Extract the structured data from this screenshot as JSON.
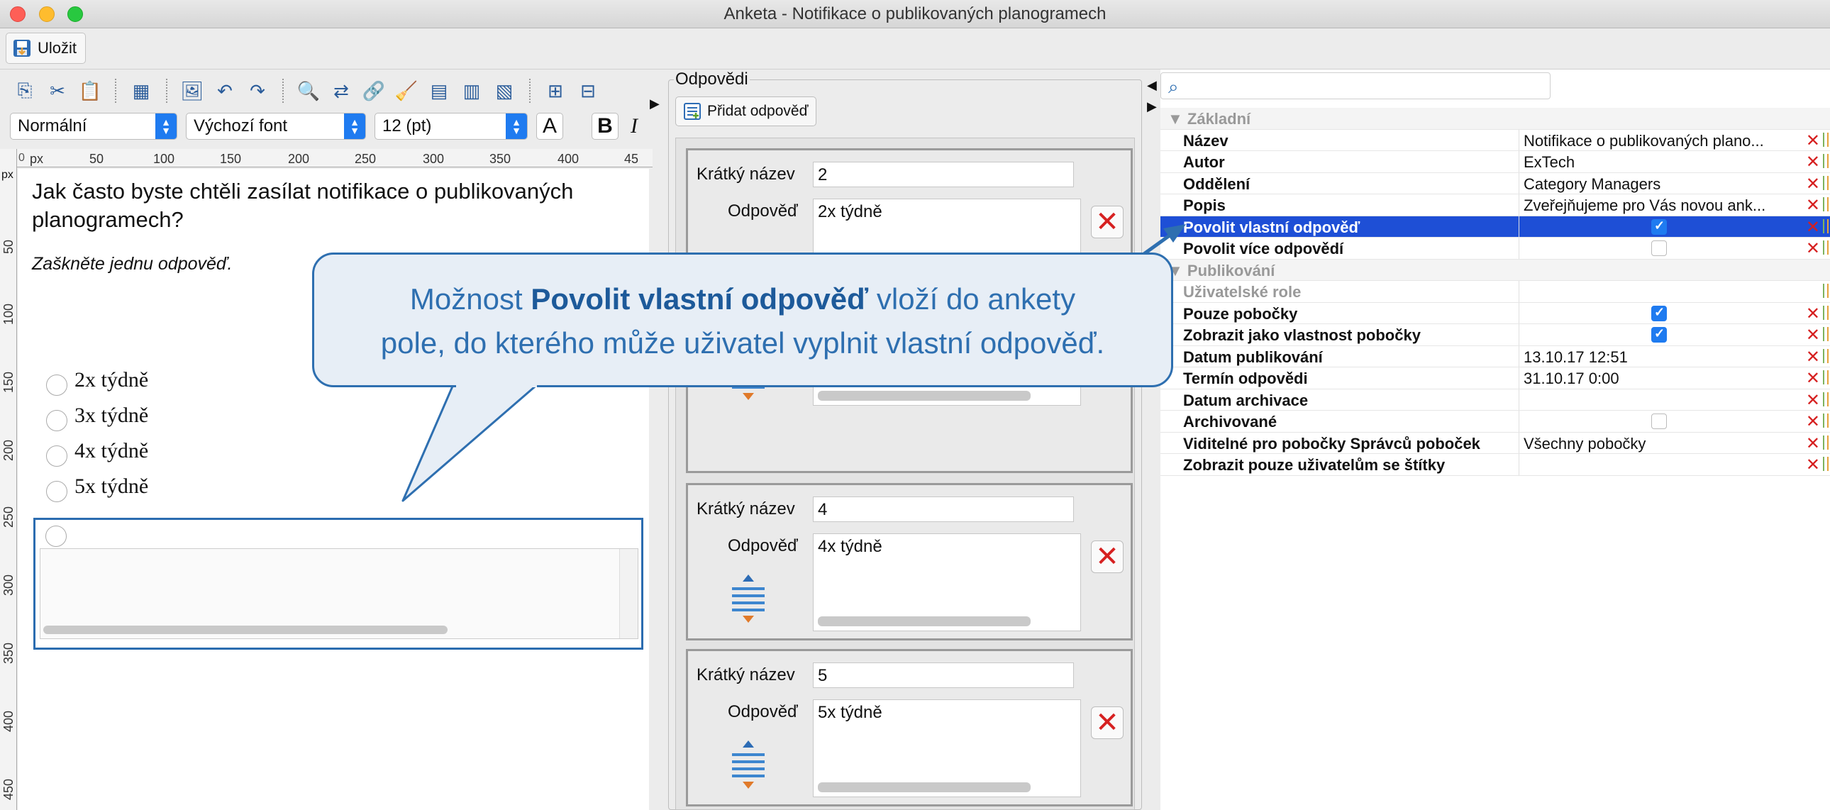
{
  "window": {
    "title": "Anketa - Notifikace o publikovaných planogramech"
  },
  "topbar": {
    "save_label": "Uložit"
  },
  "format": {
    "style": "Normální",
    "font": "Výchozí font",
    "size": "12 (pt)",
    "font_color_glyph": "A",
    "bold_glyph": "B",
    "italic_glyph": "I"
  },
  "ruler": {
    "unit": "px",
    "h_ticks": [
      "0",
      "50",
      "100",
      "150",
      "200",
      "250",
      "300",
      "350",
      "400",
      "45"
    ],
    "v_ticks": [
      "50",
      "100",
      "150",
      "200",
      "250",
      "300",
      "350",
      "400",
      "450"
    ]
  },
  "editor": {
    "question": "Jak často byste chtěli zasílat notifikace o publikovaných planogramech?",
    "instruction": "Zaškněte jednu odpověď.",
    "options": [
      "2x týdně",
      "3x týdně",
      "4x týdně",
      "5x týdně"
    ]
  },
  "answers": {
    "legend": "Odpovědi",
    "add_label": "Přidat odpověď",
    "short_label": "Krátký název",
    "answer_label": "Odpověď",
    "items": [
      {
        "short": "2",
        "text": "2x týdně"
      },
      {
        "short": "",
        "text": ""
      },
      {
        "short": "4",
        "text": "4x týdně"
      },
      {
        "short": "5",
        "text": "5x týdně"
      }
    ]
  },
  "properties": {
    "search_placeholder": "",
    "section_basic": "Základní",
    "section_publish": "Publikování",
    "rows": [
      {
        "name": "Název",
        "value": "Notifikace o publikovaných plano..."
      },
      {
        "name": "Autor",
        "value": "ExTech"
      },
      {
        "name": "Oddělení",
        "value": "Category Managers"
      },
      {
        "name": "Popis",
        "value": "Zveřejňujeme pro Vás novou ank..."
      },
      {
        "name": "Povolit vlastní odpověď",
        "value": "",
        "checked": true
      },
      {
        "name": "Povolit více odpovědí",
        "value": "",
        "checked": false
      },
      {
        "name": "Uživatelské role",
        "value": ""
      },
      {
        "name": "Pouze pobočky",
        "value": "",
        "checked": true
      },
      {
        "name": "Zobrazit jako vlastnost pobočky",
        "value": "",
        "checked": true
      },
      {
        "name": "Datum publikování",
        "value": "13.10.17 12:51"
      },
      {
        "name": "Termín odpovědi",
        "value": "31.10.17 0:00"
      },
      {
        "name": "Datum archivace",
        "value": ""
      },
      {
        "name": "Archivované",
        "value": "",
        "checked": false
      },
      {
        "name": "Viditelné pro pobočky Správců poboček",
        "value": "Všechny pobočky"
      },
      {
        "name": "Zobrazit pouze uživatelům se štítky",
        "value": ""
      }
    ]
  },
  "callout": {
    "prefix": "Možnost ",
    "bold": "Povolit vlastní odpověď",
    "suffix": " vloží do ankety",
    "line2": "pole, do kterého může uživatel vyplnit vlastní odpověď."
  },
  "colors": {
    "accent": "#2e6fb0",
    "selection": "#1e4fd6",
    "delete": "#d62020"
  }
}
